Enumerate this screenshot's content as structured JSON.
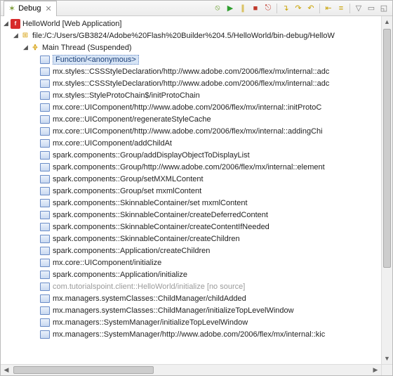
{
  "tab": {
    "title": "Debug"
  },
  "toolbar_icons": [
    "skip-all-bp",
    "resume",
    "suspend",
    "terminate",
    "disconnect",
    "step-into",
    "step-over",
    "step-return",
    "drop",
    "use-step-filters",
    "view-menu",
    "minimize",
    "maximize"
  ],
  "tree": {
    "launch": {
      "label": "HelloWorld [Web Application]",
      "target": {
        "label": "file:/C:/Users/GB3824/Adobe%20Flash%20Builder%204.5/HelloWorld/bin-debug/HelloW",
        "thread": {
          "label": "Main Thread (Suspended)",
          "selected_frame": "Function/<anonymous>",
          "frames": [
            "mx.styles::CSSStyleDeclaration/http://www.adobe.com/2006/flex/mx/internal::adc",
            "mx.styles::CSSStyleDeclaration/http://www.adobe.com/2006/flex/mx/internal::adc",
            "mx.styles::StyleProtoChain$/initProtoChain",
            "mx.core::UIComponent/http://www.adobe.com/2006/flex/mx/internal::initProtoC",
            "mx.core::UIComponent/regenerateStyleCache",
            "mx.core::UIComponent/http://www.adobe.com/2006/flex/mx/internal::addingChi",
            "mx.core::UIComponent/addChildAt",
            "spark.components::Group/addDisplayObjectToDisplayList",
            "spark.components::Group/http://www.adobe.com/2006/flex/mx/internal::element",
            "spark.components::Group/setMXMLContent",
            "spark.components::Group/set mxmlContent",
            "spark.components::SkinnableContainer/set mxmlContent",
            "spark.components::SkinnableContainer/createDeferredContent",
            "spark.components::SkinnableContainer/createContentIfNeeded",
            "spark.components::SkinnableContainer/createChildren",
            "spark.components::Application/createChildren",
            "mx.core::UIComponent/initialize",
            "spark.components::Application/initialize",
            "__FADED__com.tutorialspoint.client::HelloWorld/initialize [no source]",
            "mx.managers.systemClasses::ChildManager/childAdded",
            "mx.managers.systemClasses::ChildManager/initializeTopLevelWindow",
            "mx.managers::SystemManager/initializeTopLevelWindow",
            "mx.managers::SystemManager/http://www.adobe.com/2006/flex/mx/internal::kic"
          ]
        }
      }
    }
  }
}
